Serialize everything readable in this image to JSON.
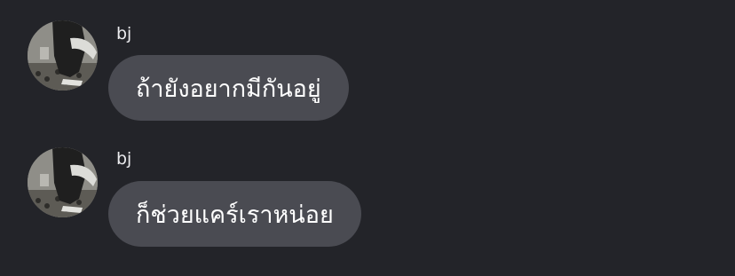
{
  "messages": [
    {
      "sender": "bj",
      "text": "ถ้ายังอยากมีกันอยู่",
      "avatar_icon": "user-photo-avatar"
    },
    {
      "sender": "bj",
      "text": "ก็ช่วยแคร์เราหน่อย",
      "avatar_icon": "user-photo-avatar"
    }
  ],
  "colors": {
    "background": "#232429",
    "bubble": "#4a4b52",
    "text": "#ffffff"
  }
}
